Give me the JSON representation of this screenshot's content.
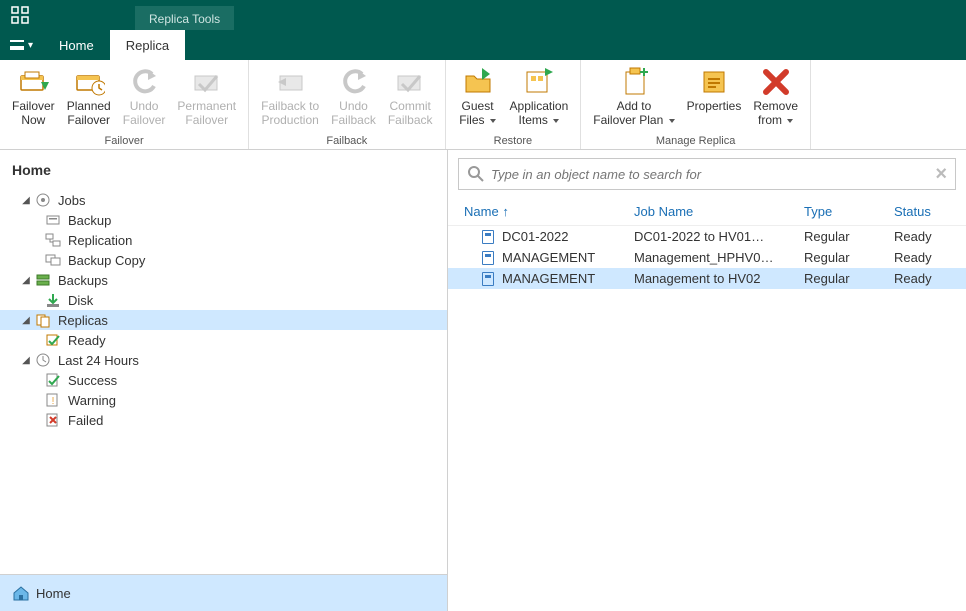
{
  "titlebar": {
    "contextTab": "Replica Tools"
  },
  "menubar": {
    "home": "Home",
    "replica": "Replica"
  },
  "ribbon": {
    "groups": {
      "failover": {
        "label": "Failover",
        "items": [
          {
            "label": "Failover\nNow"
          },
          {
            "label": "Planned\nFailover"
          },
          {
            "label": "Undo\nFailover"
          },
          {
            "label": "Permanent\nFailover"
          }
        ]
      },
      "failback": {
        "label": "Failback",
        "items": [
          {
            "label": "Failback to\nProduction"
          },
          {
            "label": "Undo\nFailback"
          },
          {
            "label": "Commit\nFailback"
          }
        ]
      },
      "restore": {
        "label": "Restore",
        "items": [
          {
            "label": "Guest\nFiles"
          },
          {
            "label": "Application\nItems"
          }
        ]
      },
      "manage": {
        "label": "Manage Replica",
        "items": [
          {
            "label": "Add to\nFailover Plan"
          },
          {
            "label": "Properties"
          },
          {
            "label": "Remove\nfrom"
          }
        ]
      }
    }
  },
  "sidebar": {
    "heading": "Home",
    "tree": {
      "jobs": {
        "label": "Jobs",
        "children": {
          "backup": "Backup",
          "replication": "Replication",
          "backupcopy": "Backup Copy"
        }
      },
      "backups": {
        "label": "Backups",
        "children": {
          "disk": "Disk"
        }
      },
      "replicas": {
        "label": "Replicas",
        "children": {
          "ready": "Ready"
        }
      },
      "last24": {
        "label": "Last 24 Hours",
        "children": {
          "success": "Success",
          "warning": "Warning",
          "failed": "Failed"
        }
      }
    },
    "homeButton": "Home"
  },
  "main": {
    "searchPlaceholder": "Type in an object name to search for",
    "columns": {
      "name": "Name",
      "job": "Job Name",
      "type": "Type",
      "status": "Status"
    },
    "rows": [
      {
        "name": "DC01-2022",
        "job": "DC01-2022 to HV01…",
        "type": "Regular",
        "status": "Ready"
      },
      {
        "name": "MANAGEMENT",
        "job": "Management_HPHV0…",
        "type": "Regular",
        "status": "Ready"
      },
      {
        "name": "MANAGEMENT",
        "job": "Management to HV02",
        "type": "Regular",
        "status": "Ready"
      }
    ]
  }
}
